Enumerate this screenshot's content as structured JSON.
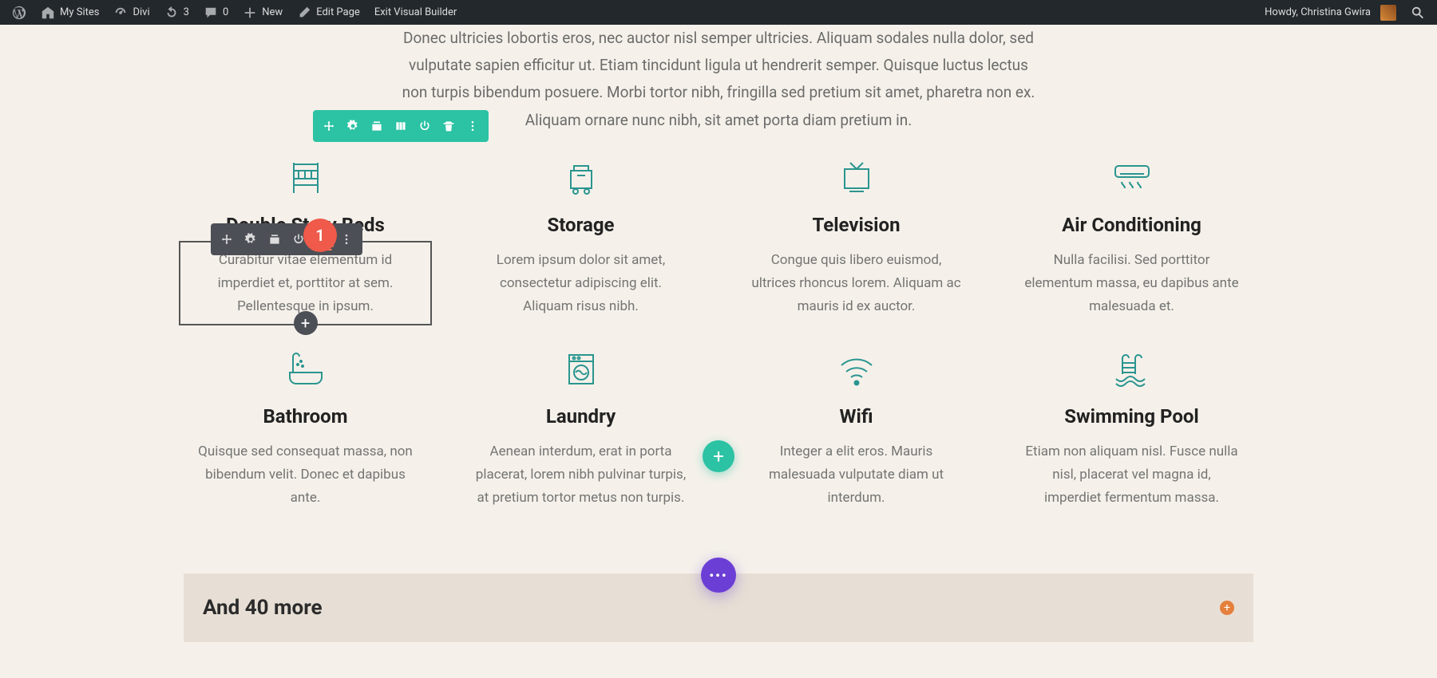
{
  "admin_bar": {
    "my_sites": "My Sites",
    "site_name": "Divi",
    "updates": "3",
    "comments": "0",
    "new": "New",
    "edit_page": "Edit Page",
    "exit_vb": "Exit Visual Builder",
    "howdy": "Howdy, Christina Gwira"
  },
  "intro_text": "Donec ultricies lobortis eros, nec auctor nisl semper ultricies. Aliquam sodales nulla dolor, sed vulputate sapien efficitur ut. Etiam tincidunt ligula ut hendrerit semper. Quisque luctus lectus non turpis bibendum posuere. Morbi tortor nibh, fringilla sed pretium sit amet, pharetra non ex. Aliquam ornare nunc nibh, sit amet porta diam pretium in.",
  "features": [
    {
      "title": "Double Story Beds",
      "text": "Curabitur vitae elementum id imperdiet et, porttitor at sem. Pellentesque in ipsum."
    },
    {
      "title": "Storage",
      "text": "Lorem ipsum dolor sit amet, consectetur adipiscing elit. Aliquam risus nibh."
    },
    {
      "title": "Television",
      "text": "Congue quis libero euismod, ultrices rhoncus lorem. Aliquam ac mauris id ex auctor."
    },
    {
      "title": "Air Conditioning",
      "text": "Nulla facilisi. Sed porttitor elementum massa, eu dapibus ante malesuada et."
    },
    {
      "title": "Bathroom",
      "text": "Quisque sed consequat massa, non bibendum velit. Donec et dapibus ante."
    },
    {
      "title": "Laundry",
      "text": "Aenean interdum, erat in porta placerat, lorem nibh pulvinar turpis, at pretium tortor metus non turpis."
    },
    {
      "title": "Wifi",
      "text": "Integer a elit eros. Mauris malesuada vulputate diam ut interdum."
    },
    {
      "title": "Swimming Pool",
      "text": "Etiam non aliquam nisl. Fusce nulla nisl, placerat vel magna id, imperdiet fermentum massa."
    }
  ],
  "more_heading": "And 40 more",
  "step_badge": "1",
  "colors": {
    "accent": "#2cc2a4",
    "toolbar_dark": "#4c4f56",
    "badge": "#ef5a4a",
    "fab": "#6b3fd5",
    "icon": "#2b9590"
  }
}
